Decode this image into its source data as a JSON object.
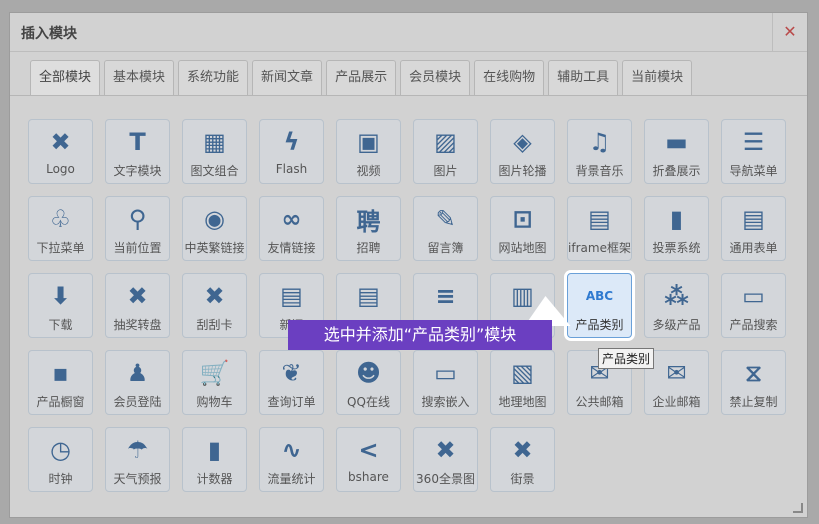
{
  "dialog": {
    "title": "插入模块",
    "close_glyph": "✕"
  },
  "tabs": [
    "全部模块",
    "基本模块",
    "系统功能",
    "新闻文章",
    "产品展示",
    "会员模块",
    "在线购物",
    "辅助工具",
    "当前模块"
  ],
  "modules": [
    {
      "label": "Logo",
      "icon": "logo-icon",
      "glyph": "✖"
    },
    {
      "label": "文字模块",
      "icon": "text-icon",
      "glyph": "T"
    },
    {
      "label": "图文组合",
      "icon": "image-text-icon",
      "glyph": "▦"
    },
    {
      "label": "Flash",
      "icon": "flash-icon",
      "glyph": "ϟ"
    },
    {
      "label": "视频",
      "icon": "video-icon",
      "glyph": "▣"
    },
    {
      "label": "图片",
      "icon": "picture-icon",
      "glyph": "▨"
    },
    {
      "label": "图片轮播",
      "icon": "slideshow-icon",
      "glyph": "◈"
    },
    {
      "label": "背景音乐",
      "icon": "music-icon",
      "glyph": "♫"
    },
    {
      "label": "折叠展示",
      "icon": "fold-icon",
      "glyph": "▬"
    },
    {
      "label": "导航菜单",
      "icon": "nav-menu-icon",
      "glyph": "☰"
    },
    {
      "label": "下拉菜单",
      "icon": "dropdown-menu-icon",
      "glyph": "♧"
    },
    {
      "label": "当前位置",
      "icon": "location-icon",
      "glyph": "⚲"
    },
    {
      "label": "中英繁链接",
      "icon": "globe-icon",
      "glyph": "◉"
    },
    {
      "label": "友情链接",
      "icon": "link-icon",
      "glyph": "∞"
    },
    {
      "label": "招聘",
      "icon": "recruit-icon",
      "glyph": "聘"
    },
    {
      "label": "留言簿",
      "icon": "guestbook-icon",
      "glyph": "✎"
    },
    {
      "label": "网站地图",
      "icon": "sitemap-icon",
      "glyph": "⊡"
    },
    {
      "label": "iframe框架",
      "icon": "iframe-icon",
      "glyph": "▤"
    },
    {
      "label": "投票系统",
      "icon": "vote-icon",
      "glyph": "▮"
    },
    {
      "label": "通用表单",
      "icon": "form-icon",
      "glyph": "▤"
    },
    {
      "label": "下载",
      "icon": "download-icon",
      "glyph": "⬇"
    },
    {
      "label": "抽奖转盘",
      "icon": "lottery-icon",
      "glyph": "✖"
    },
    {
      "label": "刮刮卡",
      "icon": "scratch-card-icon",
      "glyph": "✖"
    },
    {
      "label": "新闻",
      "icon": "news-icon",
      "glyph": "▤"
    },
    {
      "label": "",
      "icon": "news-list-icon",
      "glyph": "▤"
    },
    {
      "label": "",
      "icon": "news-badge-icon",
      "glyph": "≡"
    },
    {
      "label": "",
      "icon": "news-category-icon",
      "glyph": "▥"
    },
    {
      "label": "产品类别",
      "icon": "product-category-icon",
      "glyph": "ABC",
      "selected": true
    },
    {
      "label": "多级产品",
      "icon": "multilevel-product-icon",
      "glyph": "⁂"
    },
    {
      "label": "产品搜索",
      "icon": "product-search-icon",
      "glyph": "▭"
    },
    {
      "label": "产品橱窗",
      "icon": "product-window-icon",
      "glyph": "▪"
    },
    {
      "label": "会员登陆",
      "icon": "member-login-icon",
      "glyph": "♟"
    },
    {
      "label": "购物车",
      "icon": "cart-icon",
      "glyph": "🛒"
    },
    {
      "label": "查询订单",
      "icon": "order-icon",
      "glyph": "❦"
    },
    {
      "label": "QQ在线",
      "icon": "qq-icon",
      "glyph": "☻"
    },
    {
      "label": "搜索嵌入",
      "icon": "search-embed-icon",
      "glyph": "▭"
    },
    {
      "label": "地理地图",
      "icon": "map-icon",
      "glyph": "▧"
    },
    {
      "label": "公共邮箱",
      "icon": "mail-icon",
      "glyph": "✉"
    },
    {
      "label": "企业邮箱",
      "icon": "enterprise-mail-icon",
      "glyph": "✉"
    },
    {
      "label": "禁止复制",
      "icon": "no-copy-icon",
      "glyph": "⧖"
    },
    {
      "label": "时钟",
      "icon": "clock-icon",
      "glyph": "◷"
    },
    {
      "label": "天气预报",
      "icon": "weather-icon",
      "glyph": "☂"
    },
    {
      "label": "计数器",
      "icon": "counter-icon",
      "glyph": "▮"
    },
    {
      "label": "流量统计",
      "icon": "stats-icon",
      "glyph": "∿"
    },
    {
      "label": "bshare",
      "icon": "share-icon",
      "glyph": "<"
    },
    {
      "label": "360全景图",
      "icon": "panorama-icon",
      "glyph": "✖"
    },
    {
      "label": "街景",
      "icon": "street-view-icon",
      "glyph": "✖"
    }
  ],
  "callout": {
    "text": "选中并添加“产品类别”模块"
  },
  "tooltip": {
    "text": "产品类别"
  },
  "colors": {
    "accent": "#3f6691",
    "callout_bg": "#6b3fc1",
    "close": "#b94a4a"
  }
}
